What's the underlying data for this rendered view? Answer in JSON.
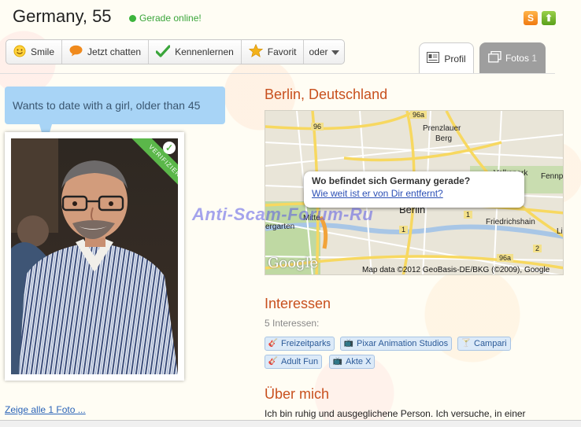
{
  "profile": {
    "name_age": "Germany, 55",
    "online_status": "Gerade online!",
    "status_color": "#3aa53a"
  },
  "actions": [
    {
      "label": "Smile",
      "icon": "smile-icon"
    },
    {
      "label": "Jetzt chatten",
      "icon": "chat-bubble-icon"
    },
    {
      "label": "Kennenlernen",
      "icon": "checkmark-icon"
    },
    {
      "label": "Favorit",
      "icon": "star-icon"
    },
    {
      "label": "oder",
      "icon": "chevron-down-icon"
    }
  ],
  "tabs": {
    "profil": "Profil",
    "fotos": "Fotos",
    "fotos_count": "1"
  },
  "bubble_text": "Wants to date with a girl, older than 45",
  "badge": "VERIFIZIERT",
  "photos_link": "Zeige alle 1 Foto ...",
  "location": {
    "title": "Berlin, Deutschland",
    "map_question": "Wo befindet sich Germany gerade?",
    "map_link": "Wie weit ist er von Dir entfernt?",
    "map_credit": "Map data ©2012 GeoBasis-DE/BKG (©2009), Google",
    "google_logo": "Google",
    "map_labels": {
      "center": "Berlin",
      "prenzlauer": "Prenzlauer",
      "berg": "Berg",
      "friedrichshain": "Friedrichshain",
      "mitte": "Mitte",
      "garten": "ergarten",
      "fennp": "Fennp",
      "li": "Li",
      "volkspark": "Volkspark",
      "r96": "96",
      "r96a_top": "96a",
      "r96a_bot": "96a",
      "r1": "1",
      "r1b": "1",
      "r2": "2"
    }
  },
  "watermark": "Anti-Scam-Forum-Ru",
  "interests": {
    "title": "Interessen",
    "count_label": "5 Interessen:",
    "items": [
      {
        "label": "Freizeitparks",
        "icon": "guitar-icon"
      },
      {
        "label": "Pixar Animation Studios",
        "icon": "tv-icon"
      },
      {
        "label": "Campari",
        "icon": "drink-icon"
      },
      {
        "label": "Adult Fun",
        "icon": "guitar-icon"
      },
      {
        "label": "Akte X",
        "icon": "tv-icon"
      }
    ]
  },
  "about": {
    "title": "Über mich",
    "text": "Ich bin ruhig und ausgeglichene Person. Ich versuche, in einer"
  },
  "colors": {
    "accent_heading": "#c8501e",
    "link": "#2b64b8",
    "bubble": "#a8d4f6",
    "ribbon": "#5bb74a"
  }
}
